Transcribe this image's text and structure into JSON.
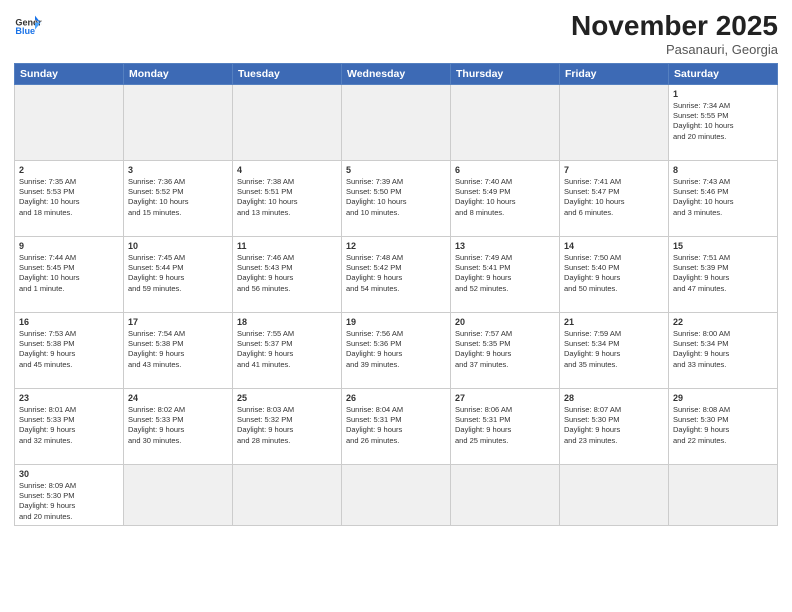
{
  "logo": {
    "line1": "General",
    "line2": "Blue"
  },
  "title": "November 2025",
  "subtitle": "Pasanauri, Georgia",
  "weekdays": [
    "Sunday",
    "Monday",
    "Tuesday",
    "Wednesday",
    "Thursday",
    "Friday",
    "Saturday"
  ],
  "days": [
    {
      "num": "",
      "info": "",
      "empty": true
    },
    {
      "num": "",
      "info": "",
      "empty": true
    },
    {
      "num": "",
      "info": "",
      "empty": true
    },
    {
      "num": "",
      "info": "",
      "empty": true
    },
    {
      "num": "",
      "info": "",
      "empty": true
    },
    {
      "num": "",
      "info": "",
      "empty": true
    },
    {
      "num": "1",
      "info": "Sunrise: 7:34 AM\nSunset: 5:55 PM\nDaylight: 10 hours\nand 20 minutes."
    }
  ],
  "week2": [
    {
      "num": "2",
      "info": "Sunrise: 7:35 AM\nSunset: 5:53 PM\nDaylight: 10 hours\nand 18 minutes."
    },
    {
      "num": "3",
      "info": "Sunrise: 7:36 AM\nSunset: 5:52 PM\nDaylight: 10 hours\nand 15 minutes."
    },
    {
      "num": "4",
      "info": "Sunrise: 7:38 AM\nSunset: 5:51 PM\nDaylight: 10 hours\nand 13 minutes."
    },
    {
      "num": "5",
      "info": "Sunrise: 7:39 AM\nSunset: 5:50 PM\nDaylight: 10 hours\nand 10 minutes."
    },
    {
      "num": "6",
      "info": "Sunrise: 7:40 AM\nSunset: 5:49 PM\nDaylight: 10 hours\nand 8 minutes."
    },
    {
      "num": "7",
      "info": "Sunrise: 7:41 AM\nSunset: 5:47 PM\nDaylight: 10 hours\nand 6 minutes."
    },
    {
      "num": "8",
      "info": "Sunrise: 7:43 AM\nSunset: 5:46 PM\nDaylight: 10 hours\nand 3 minutes."
    }
  ],
  "week3": [
    {
      "num": "9",
      "info": "Sunrise: 7:44 AM\nSunset: 5:45 PM\nDaylight: 10 hours\nand 1 minute."
    },
    {
      "num": "10",
      "info": "Sunrise: 7:45 AM\nSunset: 5:44 PM\nDaylight: 9 hours\nand 59 minutes."
    },
    {
      "num": "11",
      "info": "Sunrise: 7:46 AM\nSunset: 5:43 PM\nDaylight: 9 hours\nand 56 minutes."
    },
    {
      "num": "12",
      "info": "Sunrise: 7:48 AM\nSunset: 5:42 PM\nDaylight: 9 hours\nand 54 minutes."
    },
    {
      "num": "13",
      "info": "Sunrise: 7:49 AM\nSunset: 5:41 PM\nDaylight: 9 hours\nand 52 minutes."
    },
    {
      "num": "14",
      "info": "Sunrise: 7:50 AM\nSunset: 5:40 PM\nDaylight: 9 hours\nand 50 minutes."
    },
    {
      "num": "15",
      "info": "Sunrise: 7:51 AM\nSunset: 5:39 PM\nDaylight: 9 hours\nand 47 minutes."
    }
  ],
  "week4": [
    {
      "num": "16",
      "info": "Sunrise: 7:53 AM\nSunset: 5:38 PM\nDaylight: 9 hours\nand 45 minutes."
    },
    {
      "num": "17",
      "info": "Sunrise: 7:54 AM\nSunset: 5:38 PM\nDaylight: 9 hours\nand 43 minutes."
    },
    {
      "num": "18",
      "info": "Sunrise: 7:55 AM\nSunset: 5:37 PM\nDaylight: 9 hours\nand 41 minutes."
    },
    {
      "num": "19",
      "info": "Sunrise: 7:56 AM\nSunset: 5:36 PM\nDaylight: 9 hours\nand 39 minutes."
    },
    {
      "num": "20",
      "info": "Sunrise: 7:57 AM\nSunset: 5:35 PM\nDaylight: 9 hours\nand 37 minutes."
    },
    {
      "num": "21",
      "info": "Sunrise: 7:59 AM\nSunset: 5:34 PM\nDaylight: 9 hours\nand 35 minutes."
    },
    {
      "num": "22",
      "info": "Sunrise: 8:00 AM\nSunset: 5:34 PM\nDaylight: 9 hours\nand 33 minutes."
    }
  ],
  "week5": [
    {
      "num": "23",
      "info": "Sunrise: 8:01 AM\nSunset: 5:33 PM\nDaylight: 9 hours\nand 32 minutes."
    },
    {
      "num": "24",
      "info": "Sunrise: 8:02 AM\nSunset: 5:33 PM\nDaylight: 9 hours\nand 30 minutes."
    },
    {
      "num": "25",
      "info": "Sunrise: 8:03 AM\nSunset: 5:32 PM\nDaylight: 9 hours\nand 28 minutes."
    },
    {
      "num": "26",
      "info": "Sunrise: 8:04 AM\nSunset: 5:31 PM\nDaylight: 9 hours\nand 26 minutes."
    },
    {
      "num": "27",
      "info": "Sunrise: 8:06 AM\nSunset: 5:31 PM\nDaylight: 9 hours\nand 25 minutes."
    },
    {
      "num": "28",
      "info": "Sunrise: 8:07 AM\nSunset: 5:30 PM\nDaylight: 9 hours\nand 23 minutes."
    },
    {
      "num": "29",
      "info": "Sunrise: 8:08 AM\nSunset: 5:30 PM\nDaylight: 9 hours\nand 22 minutes."
    }
  ],
  "week6": [
    {
      "num": "30",
      "info": "Sunrise: 8:09 AM\nSunset: 5:30 PM\nDaylight: 9 hours\nand 20 minutes.",
      "last": true
    },
    {
      "num": "",
      "info": "",
      "empty": true,
      "last": true
    },
    {
      "num": "",
      "info": "",
      "empty": true,
      "last": true
    },
    {
      "num": "",
      "info": "",
      "empty": true,
      "last": true
    },
    {
      "num": "",
      "info": "",
      "empty": true,
      "last": true
    },
    {
      "num": "",
      "info": "",
      "empty": true,
      "last": true
    },
    {
      "num": "",
      "info": "",
      "empty": true,
      "last": true
    }
  ]
}
